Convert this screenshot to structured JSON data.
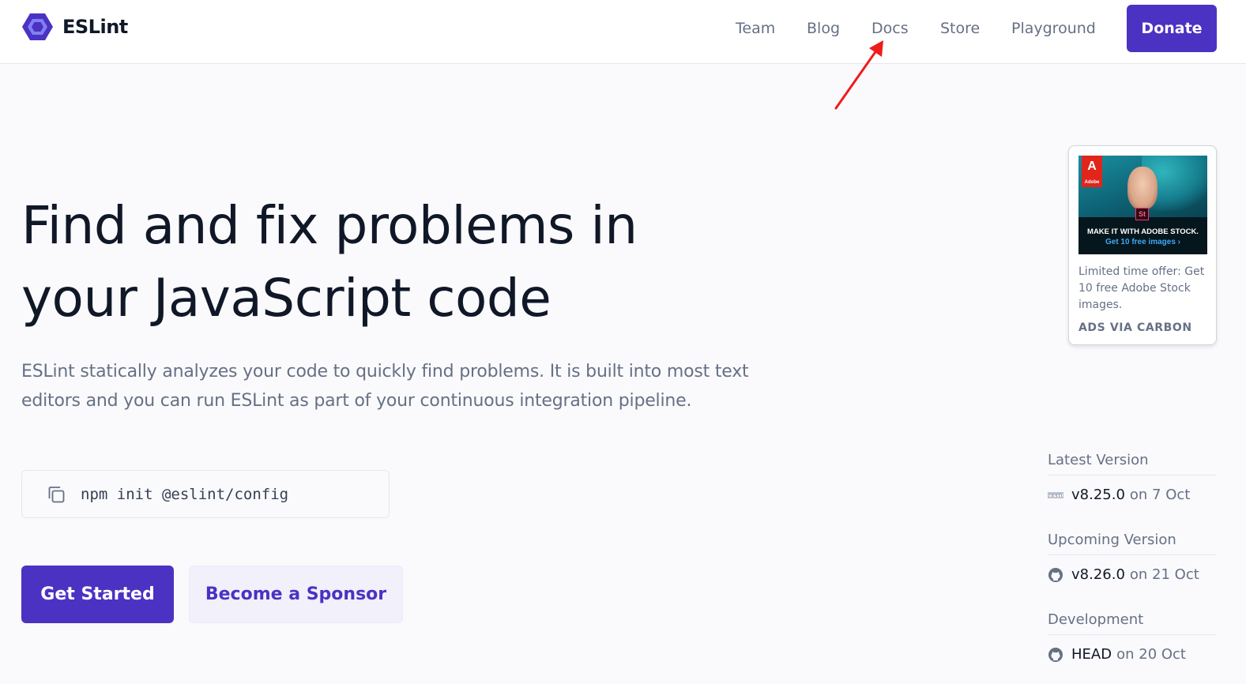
{
  "header": {
    "brand": "ESLint",
    "nav": [
      "Team",
      "Blog",
      "Docs",
      "Store",
      "Playground"
    ],
    "donate_label": "Donate"
  },
  "hero": {
    "title_line1": "Find and fix problems in",
    "title_line2": "your JavaScript code",
    "description": "ESLint statically analyzes your code to quickly find problems. It is built into most text editors and you can run ESLint as part of your continuous integration pipeline.",
    "command": "npm init @eslint/config",
    "primary_cta": "Get Started",
    "secondary_cta": "Become a Sponsor"
  },
  "ad": {
    "logo_text": "A",
    "logo_sub": "Adobe",
    "badge": "St",
    "image_headline": "MAKE IT WITH ADOBE STOCK.",
    "image_sub": "Get 10 free images ›",
    "text": "Limited time offer: Get 10 free Adobe Stock images.",
    "via": "ADS VIA CARBON"
  },
  "versions": {
    "latest_label": "Latest Version",
    "latest_version": "v8.25.0",
    "latest_date": "on 7 Oct",
    "upcoming_label": "Upcoming Version",
    "upcoming_version": "v8.26.0",
    "upcoming_date": "on 21 Oct",
    "dev_label": "Development",
    "dev_version": "HEAD",
    "dev_date": "on 20 Oct"
  },
  "icons": {
    "logo": "eslint-hexagon-icon",
    "copy": "copy-icon",
    "npm": "npm-icon",
    "github": "github-icon"
  },
  "colors": {
    "brand": "#4b32c3",
    "brand_light": "#f1f0fb",
    "text": "#101828",
    "muted": "#667085",
    "annotation": "#ee1c1c"
  }
}
